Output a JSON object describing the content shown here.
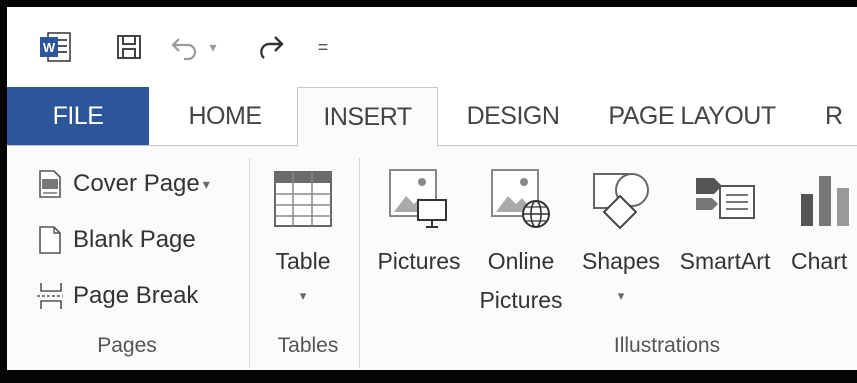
{
  "quick_access": {
    "word_logo_text": "W",
    "undo_arrow": "▾",
    "customize": "="
  },
  "tabs": [
    {
      "label": "FILE"
    },
    {
      "label": "HOME"
    },
    {
      "label": "INSERT"
    },
    {
      "label": "DESIGN"
    },
    {
      "label": "PAGE LAYOUT"
    },
    {
      "label": "R"
    }
  ],
  "groups": {
    "pages": {
      "label": "Pages",
      "items": [
        {
          "label": "Cover Page",
          "dropdown": "▾"
        },
        {
          "label": "Blank Page"
        },
        {
          "label": "Page Break"
        }
      ]
    },
    "tables": {
      "label": "Tables",
      "table": {
        "label": "Table",
        "dropdown": "▾"
      }
    },
    "illustrations": {
      "label": "Illustrations",
      "items": [
        {
          "line1": "Pictures",
          "line2": ""
        },
        {
          "line1": "Online",
          "line2": "Pictures"
        },
        {
          "line1": "Shapes",
          "line2": "▾"
        },
        {
          "line1": "SmartArt",
          "line2": ""
        },
        {
          "line1": "Chart",
          "line2": ""
        }
      ]
    }
  },
  "colors": {
    "file_tab": "#2b579a",
    "word_icon": "#2b579a",
    "ribbon_bg": "#fbfbfb",
    "frame": "#050505"
  }
}
